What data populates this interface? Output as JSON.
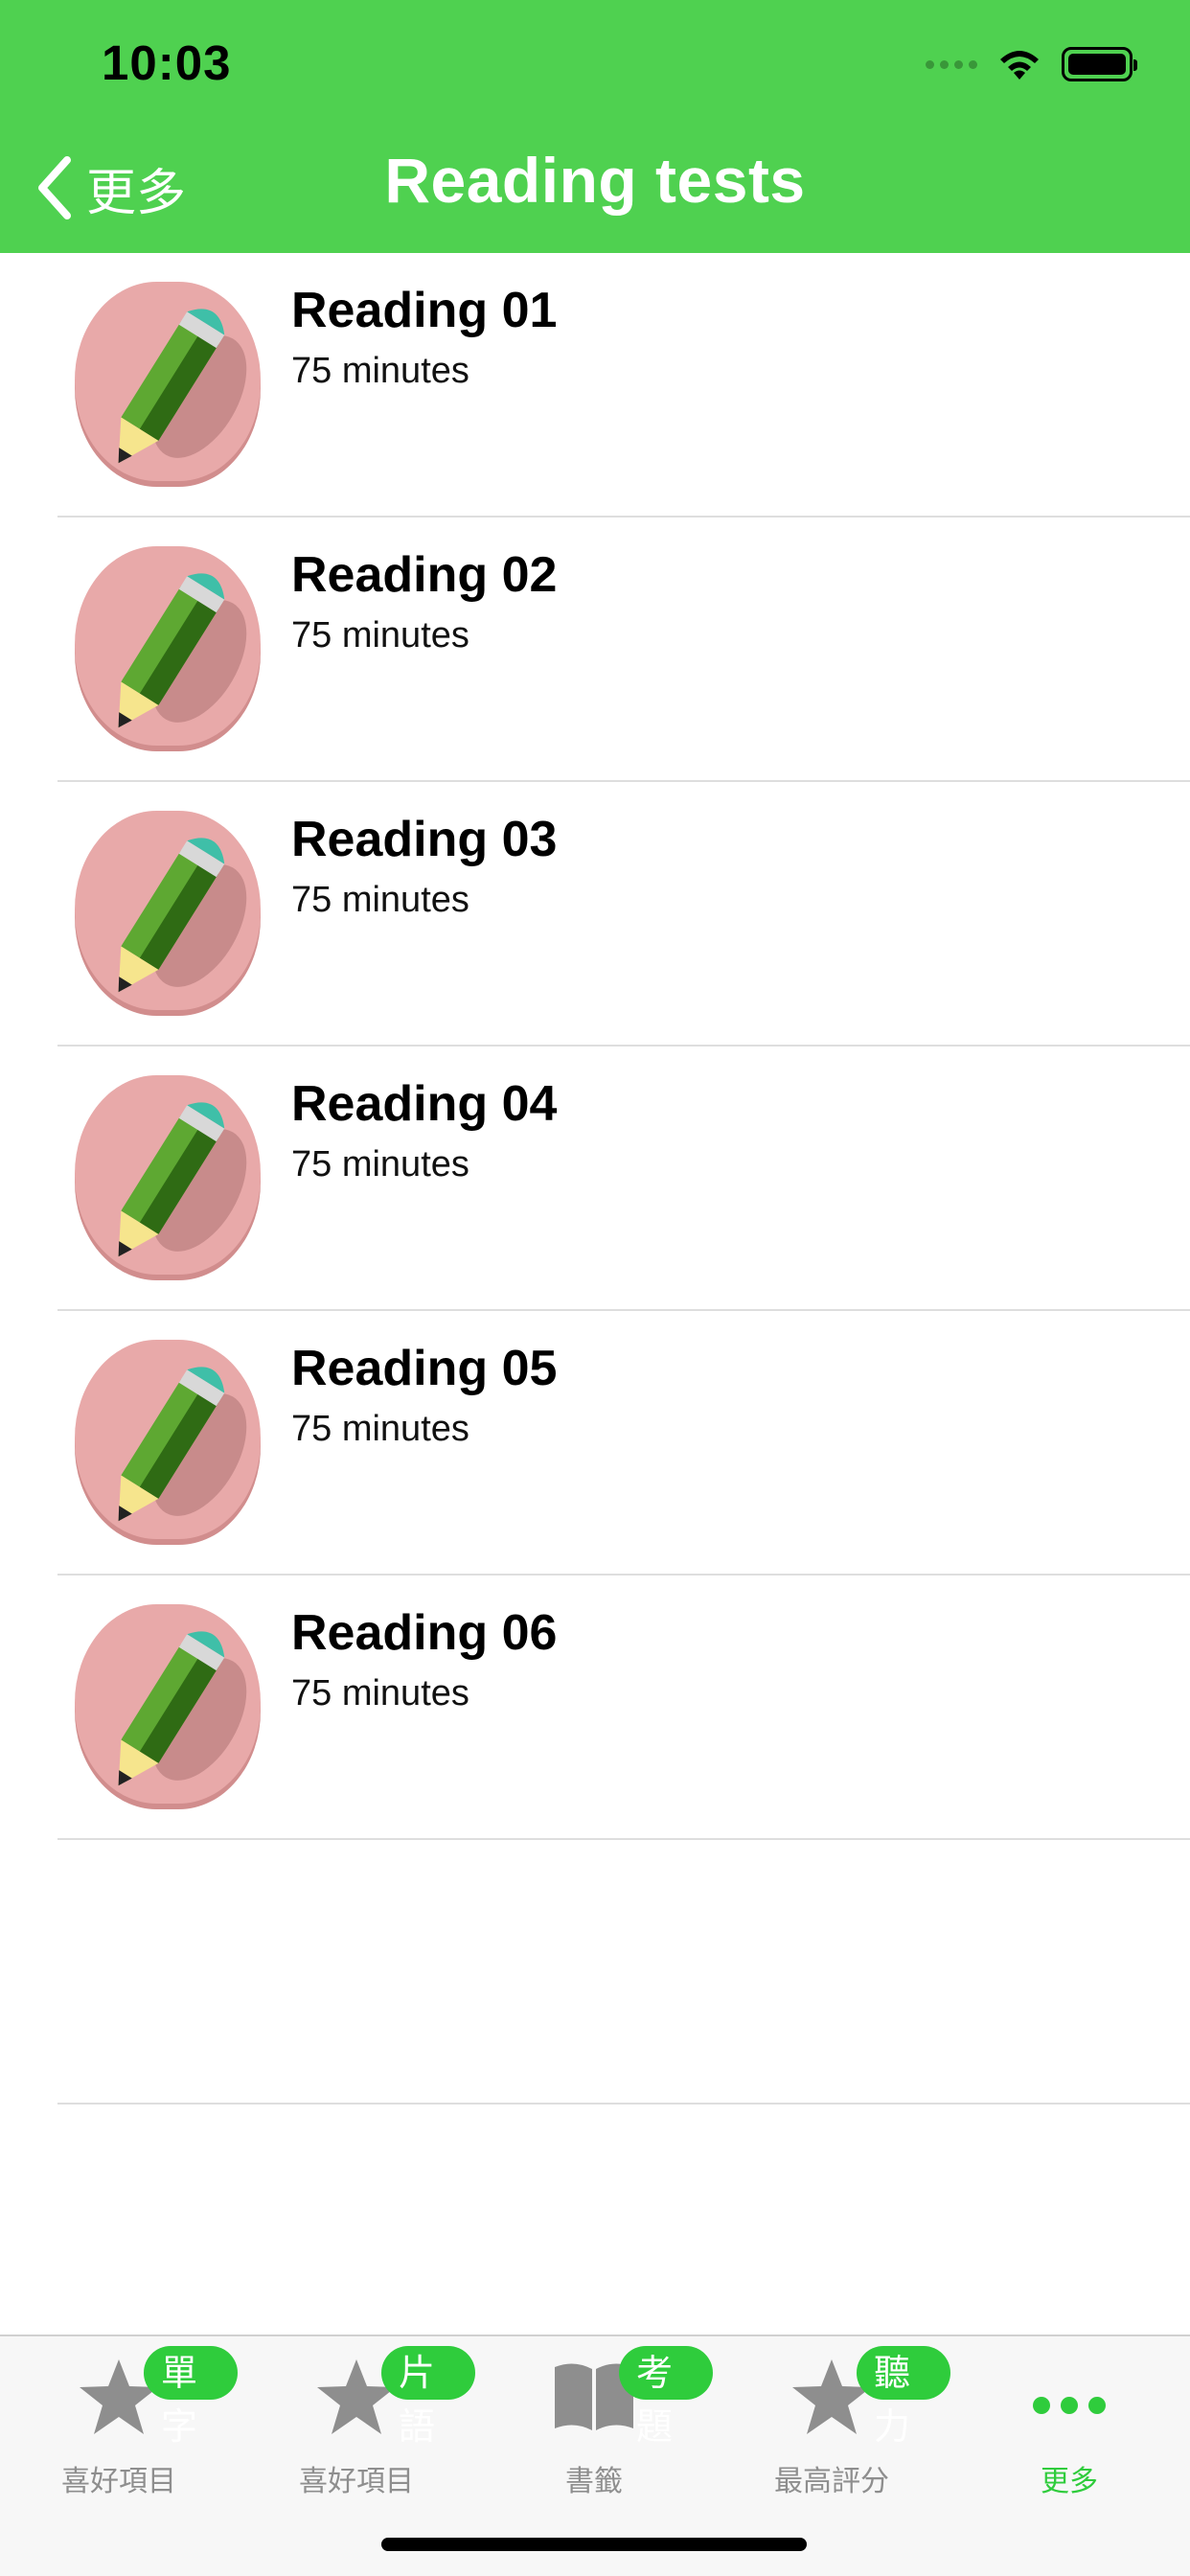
{
  "status_bar": {
    "time": "10:03"
  },
  "nav": {
    "back_label": "更多",
    "title": "Reading tests"
  },
  "list": {
    "items": [
      {
        "title": "Reading 01",
        "subtitle": "75 minutes",
        "icon": "pencil-icon"
      },
      {
        "title": "Reading 02",
        "subtitle": "75 minutes",
        "icon": "pencil-icon"
      },
      {
        "title": "Reading 03",
        "subtitle": "75 minutes",
        "icon": "pencil-icon"
      },
      {
        "title": "Reading 04",
        "subtitle": "75 minutes",
        "icon": "pencil-icon"
      },
      {
        "title": "Reading 05",
        "subtitle": "75 minutes",
        "icon": "pencil-icon"
      },
      {
        "title": "Reading 06",
        "subtitle": "75 minutes",
        "icon": "pencil-icon"
      }
    ]
  },
  "tabbar": {
    "tabs": [
      {
        "icon": "star-icon",
        "badge": "單字",
        "label": "喜好項目",
        "active": false
      },
      {
        "icon": "star-icon",
        "badge": "片語",
        "label": "喜好項目",
        "active": false
      },
      {
        "icon": "book-icon",
        "badge": "考題",
        "label": "書籤",
        "active": false
      },
      {
        "icon": "star-icon",
        "badge": "聽力",
        "label": "最高評分",
        "active": false
      },
      {
        "icon": "more-icon",
        "badge": "",
        "label": "更多",
        "active": true
      }
    ]
  },
  "colors": {
    "header": "#4fd150",
    "badge": "#2fcc3c",
    "active_tab": "#2fcc3c",
    "inactive_tab": "#8e8e8e",
    "icon_bg": "#e8a9a9"
  }
}
